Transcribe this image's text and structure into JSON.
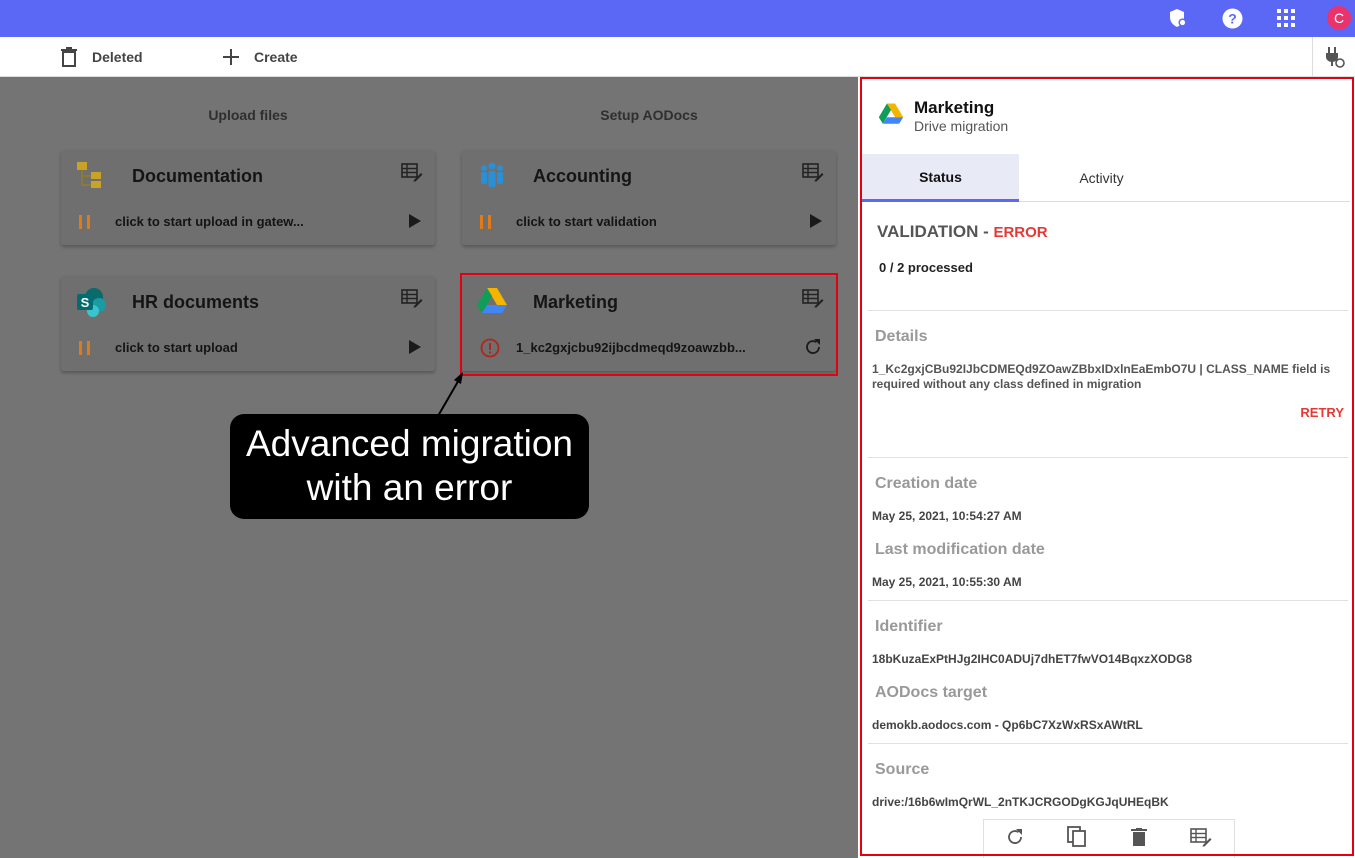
{
  "toolbar": {
    "deleted_label": "Deleted",
    "create_label": "Create"
  },
  "user": {
    "avatar_letter": "C"
  },
  "columns": {
    "upload_files": "Upload files",
    "setup_aodocs": "Setup AODocs"
  },
  "cards": [
    {
      "title": "Documentation",
      "status_text": "click to start upload in gatew...",
      "source_icon": "folder-tree-icon"
    },
    {
      "title": "Accounting",
      "status_text": "click to start validation",
      "source_icon": "people-icon"
    },
    {
      "title": "HR documents",
      "status_text": "click to start upload",
      "source_icon": "sharepoint-icon"
    },
    {
      "title": "Marketing",
      "status_text": "1_kc2gxjcbu92ijbcdmeqd9zoawzbb...",
      "source_icon": "google-drive-icon"
    }
  ],
  "callout": {
    "line1": "Advanced migration",
    "line2": "with an error"
  },
  "panel": {
    "title": "Marketing",
    "subtitle": "Drive migration",
    "tabs": {
      "status": "Status",
      "activity": "Activity"
    },
    "phase": "VALIDATION - ",
    "phase_state": "ERROR",
    "processed": "0 / 2 processed",
    "details_label": "Details",
    "details_text": "1_Kc2gxjCBu92IJbCDMEQd9ZOawZBbxIDxlnEaEmbO7U | CLASS_NAME field is required without any class defined in migration",
    "retry_label": "RETRY",
    "creation_label": "Creation date",
    "creation_value": "May 25, 2021, 10:54:27 AM",
    "modification_label": "Last modification date",
    "modification_value": "May 25, 2021, 10:55:30 AM",
    "identifier_label": "Identifier",
    "identifier_value": "18bKuzaExPtHJg2IHC0ADUj7dhET7fwVO14BqxzXODG8",
    "target_label": "AODocs target",
    "target_value": "demokb.aodocs.com - Qp6bC7XzWxRSxAWtRL",
    "source_label": "Source",
    "source_value": "drive:/16b6wImQrWL_2nTKJCRGODgKGJqUHEqBK"
  },
  "colors": {
    "accent": "#5b68f5",
    "error": "#e53935",
    "highlight": "#e3000f",
    "pause": "#e07b1a"
  }
}
